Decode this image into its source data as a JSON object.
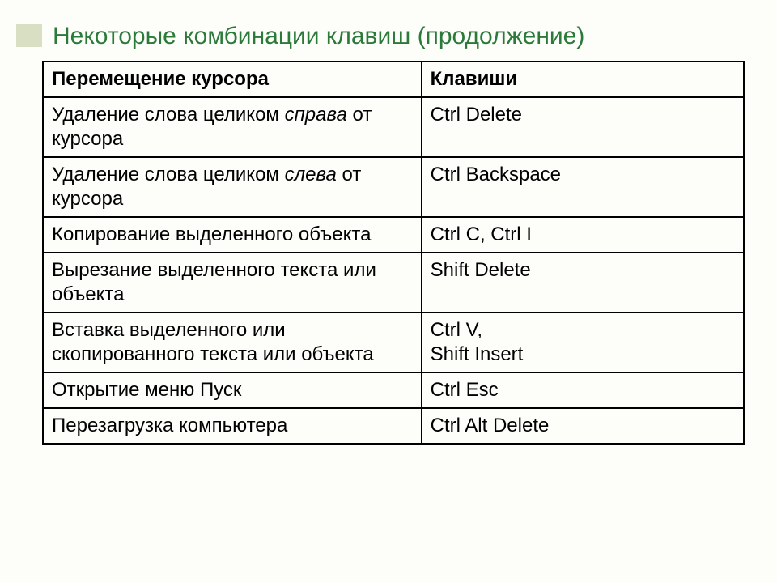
{
  "title": "Некоторые комбинации клавиш (продолжение)",
  "headers": {
    "left": "Перемещение курсора",
    "right": "Клавиши"
  },
  "rows": [
    {
      "desc_parts": [
        "Удаление слова целиком ",
        "справа",
        " от курсора"
      ],
      "keys": "Ctrl   Delete"
    },
    {
      "desc_parts": [
        "Удаление слова целиком ",
        "слева",
        " от курсора"
      ],
      "keys": "Ctrl   Backspace"
    },
    {
      "desc_parts": [
        "Копирование выделенного объекта"
      ],
      "keys": "Ctrl  C,    Ctrl  I"
    },
    {
      "desc_parts": [
        "Вырезание выделенного текста или объекта"
      ],
      "keys": "Shift  Delete"
    },
    {
      "desc_parts": [
        "Вставка выделенного или скопированного текста или объекта"
      ],
      "keys": "Ctrl  V,\nShift  Insert"
    },
    {
      "desc_parts": [
        "Открытие меню Пуск"
      ],
      "keys": "Ctrl  Esc"
    },
    {
      "desc_parts": [
        "Перезагрузка компьютера"
      ],
      "keys": "Ctrl Alt Delete"
    }
  ]
}
